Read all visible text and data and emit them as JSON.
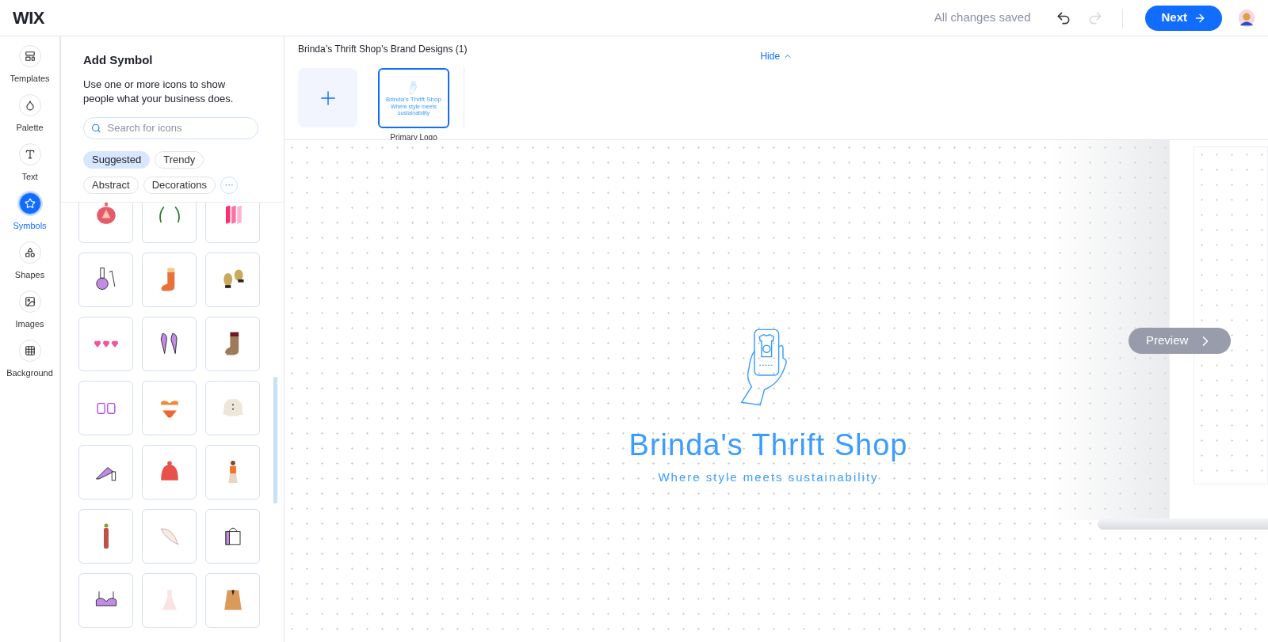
{
  "topbar": {
    "logo": "WIX",
    "save_status": "All changes saved",
    "redo_disabled": true,
    "next_button": "Next"
  },
  "rail": [
    {
      "label": "Templates",
      "selected": false
    },
    {
      "label": "Palette",
      "selected": false
    },
    {
      "label": "Text",
      "selected": false
    },
    {
      "label": "Symbols",
      "selected": true
    },
    {
      "label": "Shapes",
      "selected": false
    },
    {
      "label": "Images",
      "selected": false
    },
    {
      "label": "Background",
      "selected": false
    }
  ],
  "panel": {
    "title": "Add Symbol",
    "description": "Use one or more icons to show people what your business does.",
    "search": {
      "placeholder": "Search for icons"
    },
    "chips": [
      {
        "label": "Suggested",
        "selected": true
      },
      {
        "label": "Trendy",
        "selected": false
      },
      {
        "label": "Abstract",
        "selected": false
      },
      {
        "label": "Decorations",
        "selected": false
      }
    ],
    "more": "···"
  },
  "designs": {
    "title": "Brinda’s Thrift Shop’s Brand Designs (1)",
    "hide": "Hide",
    "items": [
      {
        "label": "Primary Logo",
        "selected": true,
        "name": "Brinda's Thrift Shop",
        "tagline": "Where style meets sustainability"
      }
    ]
  },
  "canvas": {
    "logo_name": "Brinda's Thrift Shop",
    "tagline": "Where style meets sustainability",
    "preview": "Preview"
  }
}
